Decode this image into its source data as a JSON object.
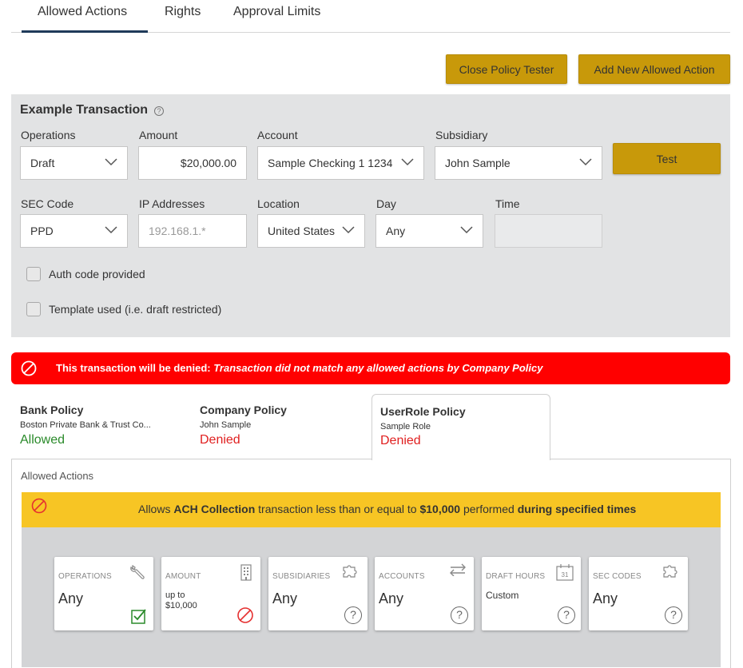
{
  "tabs": [
    {
      "label": "Allowed Actions",
      "active": true
    },
    {
      "label": "Rights",
      "active": false
    },
    {
      "label": "Approval Limits",
      "active": false
    }
  ],
  "toolbar": {
    "close_tester_label": "Close Policy Tester",
    "add_action_label": "Add New Allowed Action"
  },
  "example": {
    "title": "Example Transaction",
    "help_icon": "help-circle-icon",
    "operations": {
      "label": "Operations",
      "value": "Draft"
    },
    "amount": {
      "label": "Amount",
      "value": "$20,000.00"
    },
    "account": {
      "label": "Account",
      "value": "Sample Checking 1 1234"
    },
    "subsidiary": {
      "label": "Subsidiary",
      "value": "John Sample"
    },
    "test_label": "Test",
    "sec_code": {
      "label": "SEC Code",
      "value": "PPD"
    },
    "ip": {
      "label": "IP Addresses",
      "placeholder": "192.168.1.*"
    },
    "location": {
      "label": "Location",
      "value": "United States"
    },
    "day": {
      "label": "Day",
      "value": "Any"
    },
    "time": {
      "label": "Time",
      "value": ""
    },
    "auth_code_label": "Auth code provided",
    "template_label": "Template used (i.e. draft restricted)"
  },
  "banner": {
    "prefix": "This transaction will be denied:",
    "reason": "Transaction did not match any allowed actions by Company Policy",
    "color": "#ff0000"
  },
  "policies": [
    {
      "title": "Bank Policy",
      "sub": "Boston Private Bank & Trust Co...",
      "status": "Allowed"
    },
    {
      "title": "Company Policy",
      "sub": "John Sample",
      "status": "Denied"
    },
    {
      "title": "UserRole Policy",
      "sub": "Sample Role",
      "status": "Denied"
    }
  ],
  "detail": {
    "section_label": "Allowed Actions",
    "rule": {
      "t1": "Allows ",
      "t2": "ACH Collection",
      "t3": " transaction less than or equal to ",
      "t4": "$10,000",
      "t5": " performed ",
      "t6": "during specified times"
    },
    "cards": [
      {
        "caption": "OPERATIONS",
        "value": "Any",
        "icon": "wrench-icon",
        "status_icon": "checkbox-checked-icon"
      },
      {
        "caption": "AMOUNT",
        "value_line1": "up to",
        "value_line2": "$10,000",
        "icon": "building-icon",
        "status_icon": "denied-icon"
      },
      {
        "caption": "SUBSIDIARIES",
        "value": "Any",
        "icon": "puzzle-icon",
        "status_icon": "help-circle-icon"
      },
      {
        "caption": "ACCOUNTS",
        "value": "Any",
        "icon": "transfer-arrows-icon",
        "status_icon": "help-circle-icon"
      },
      {
        "caption": "DRAFT HOURS",
        "value": "Custom",
        "icon": "calendar-icon",
        "calendar_day": "31",
        "status_icon": "help-circle-icon"
      },
      {
        "caption": "SEC CODES",
        "value": "Any",
        "icon": "puzzle-icon",
        "status_icon": "help-circle-icon"
      }
    ],
    "help_glyph": "?"
  },
  "colors": {
    "accent": "#c8990a",
    "tab_underline": "#1f3a5a",
    "allowed": "#2a8a2a",
    "denied": "#e02020",
    "rule_bar": "#f7c524"
  }
}
